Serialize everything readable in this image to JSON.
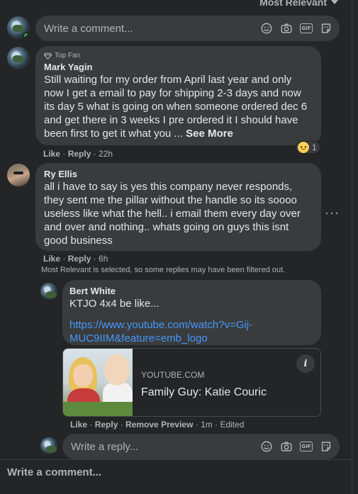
{
  "sort": {
    "label": "Most Relevant"
  },
  "top_composer": {
    "placeholder": "Write a comment..."
  },
  "comments": [
    {
      "badge": "Top Fan",
      "author": "Mark Yagin",
      "text": "Still waiting for my order from April last year and only now I get a email to pay for shipping 2-3 days and now its day 5 what is going on when someone ordered dec 6 and get there in 3 weeks I pre ordered it I should have been first to get it what you ...",
      "see_more": "See More",
      "like": "Like",
      "reply": "Reply",
      "time": "22h",
      "reaction_count": "1"
    },
    {
      "author": "Ry Ellis",
      "text": "all i have to say is yes this company never responds, they sent me the pillar without the handle so its soooo useless like what the hell.. i email them every day over and over and nothing.. whats going on guys this isnt good business",
      "like": "Like",
      "reply": "Reply",
      "time": "6h"
    }
  ],
  "filter_note": "Most Relevant is selected, so some replies may have been filtered out.",
  "reply": {
    "author": "Bert White",
    "text": "KTJO 4x4 be like...",
    "link_line1": "https://www.youtube.com/watch?v=Gij-",
    "link_line2": "MUC9IIM&feature=emb_logo",
    "preview_domain": "YOUTUBE.COM",
    "preview_title": "Family Guy: Katie Couric",
    "like": "Like",
    "reply": "Reply",
    "remove_preview": "Remove Preview",
    "time": "1m",
    "edited": "Edited"
  },
  "reply_composer": {
    "placeholder": "Write a reply..."
  },
  "bottom": {
    "write_comment": "Write a comment..."
  },
  "icons": [
    "emoji-icon",
    "camera-icon",
    "gif-icon",
    "sticker-icon",
    "chevron-down-icon",
    "info-icon",
    "more-icon"
  ],
  "colors": {
    "background": "#242526",
    "bubble": "#3a3b3c",
    "link": "#4599ff",
    "online": "#31a24c"
  }
}
